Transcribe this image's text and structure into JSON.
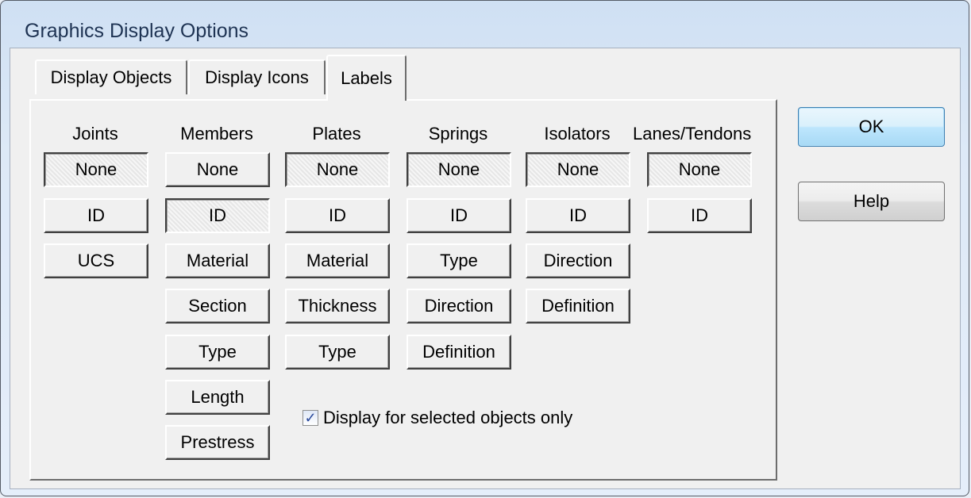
{
  "window": {
    "title": "Graphics Display Options"
  },
  "tabs": [
    {
      "label": "Display Objects",
      "active": false
    },
    {
      "label": "Display Icons",
      "active": false
    },
    {
      "label": "Labels",
      "active": true
    }
  ],
  "columns": [
    {
      "heading": "Joints",
      "buttons": [
        "None",
        "ID",
        "UCS"
      ],
      "pressed": "None"
    },
    {
      "heading": "Members",
      "buttons": [
        "None",
        "ID",
        "Material",
        "Section",
        "Type",
        "Length",
        "Prestress"
      ],
      "pressed": "ID"
    },
    {
      "heading": "Plates",
      "buttons": [
        "None",
        "ID",
        "Material",
        "Thickness",
        "Type"
      ],
      "pressed": "None"
    },
    {
      "heading": "Springs",
      "buttons": [
        "None",
        "ID",
        "Type",
        "Direction",
        "Definition"
      ],
      "pressed": "None"
    },
    {
      "heading": "Isolators",
      "buttons": [
        "None",
        "ID",
        "Direction",
        "Definition"
      ],
      "pressed": "None"
    },
    {
      "heading": "Lanes/Tendons",
      "buttons": [
        "None",
        "ID"
      ],
      "pressed": "None"
    }
  ],
  "checkbox": {
    "label": "Display for selected objects only",
    "checked": true,
    "check_glyph": "✓"
  },
  "dialog_buttons": {
    "ok": "OK",
    "help": "Help"
  },
  "colors": {
    "ok_button": "#bee6fd",
    "dialog_face": "#f0f0f0",
    "title_text": "#1e3353"
  }
}
